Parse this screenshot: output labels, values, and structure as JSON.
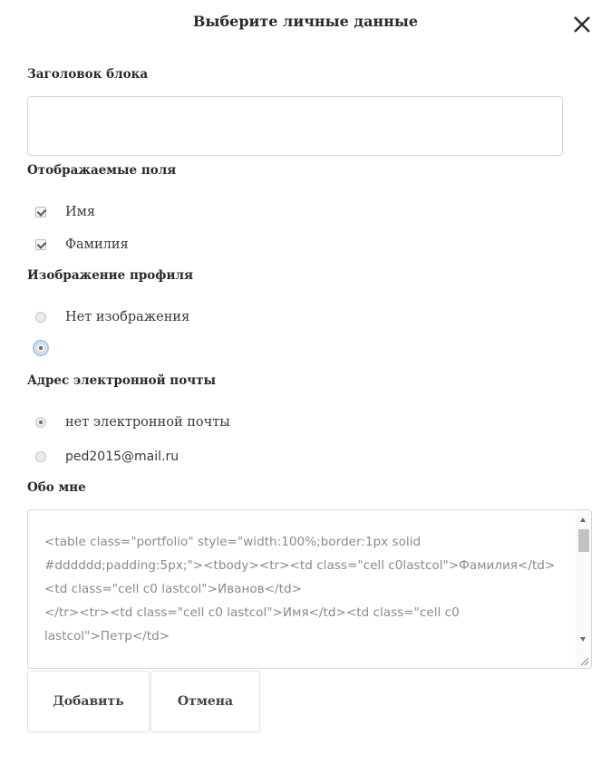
{
  "dialog": {
    "title": "Выберите личные данные",
    "close_icon": "close-icon"
  },
  "block_title": {
    "label": "Заголовок блока",
    "value": ""
  },
  "fields": {
    "label": "Отображаемые поля",
    "options": [
      {
        "label": "Имя",
        "checked": true
      },
      {
        "label": "Фамилия",
        "checked": true
      }
    ]
  },
  "profile_image": {
    "label": "Изображение профиля",
    "options": [
      {
        "label": "Нет изображения",
        "checked": false
      },
      {
        "label": "",
        "checked": true
      }
    ]
  },
  "email": {
    "label": "Адрес электронной почты",
    "options": [
      {
        "label": "нет электронной почты",
        "checked": true
      },
      {
        "label": "ped2015@mail.ru",
        "checked": false
      }
    ]
  },
  "about": {
    "label": "Обо мне",
    "value": "<table class=\"portfolio\" style=\"width:100%;border:1px solid #dddddd;padding:5px;\"><tbody><tr><td class=\"cell c0lastcol\">Фамилия</td>\n<td class=\"cell c0 lastcol\">Иванов</td>\n</tr><tr><td class=\"cell c0 lastcol\">Имя</td><td class=\"cell c0 lastcol\">Петр</td>"
  },
  "buttons": {
    "add": "Добавить",
    "cancel": "Отмена"
  }
}
